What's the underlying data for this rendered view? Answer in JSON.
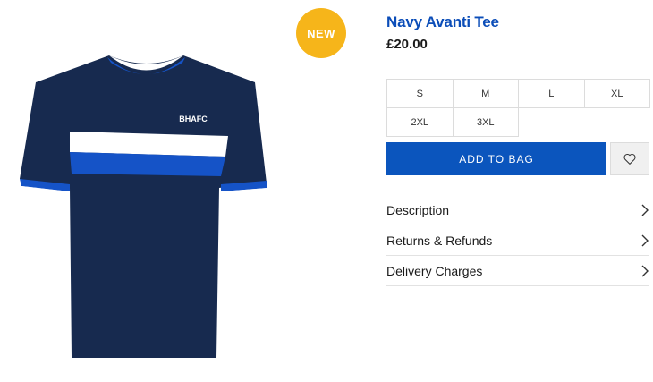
{
  "badge": {
    "label": "NEW"
  },
  "product": {
    "title": "Navy Avanti Tee",
    "price": "£20.00",
    "chest_text": "BHAFC"
  },
  "sizes": [
    "S",
    "M",
    "L",
    "XL",
    "2XL",
    "3XL"
  ],
  "actions": {
    "add_to_bag": "ADD TO BAG",
    "wishlist_icon": "heart-icon"
  },
  "accordion": [
    {
      "label": "Description"
    },
    {
      "label": "Returns & Refunds"
    },
    {
      "label": "Delivery Charges"
    }
  ],
  "colors": {
    "brand_blue": "#0b55bd",
    "title_blue": "#0b4db8",
    "badge_yellow": "#f6b51a",
    "navy": "#172a4f",
    "stripe_blue": "#1553c7"
  }
}
